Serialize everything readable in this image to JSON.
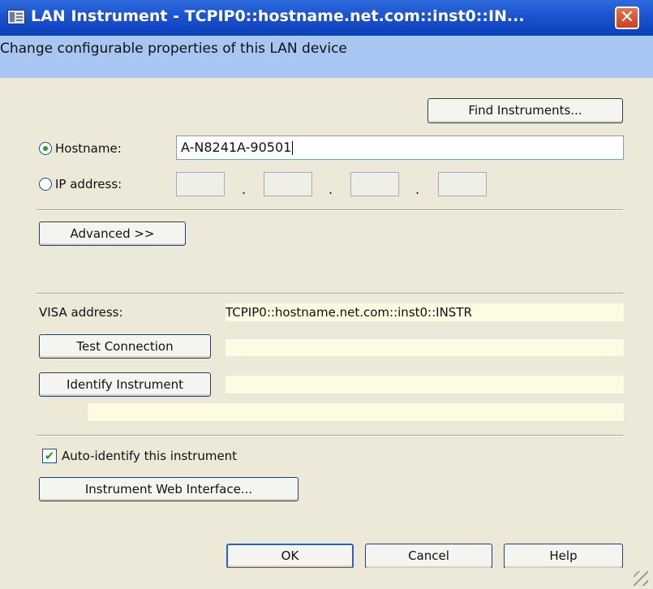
{
  "window": {
    "title": "LAN Instrument - TCPIP0::hostname.net.com::inst0::IN...",
    "description": "Change configurable properties of this LAN device",
    "close_glyph": "✕"
  },
  "buttons": {
    "find_instruments": "Find Instruments...",
    "advanced": "Advanced >>",
    "test_connection": "Test Connection",
    "identify_instrument": "Identify Instrument",
    "web_interface": "Instrument Web Interface...",
    "ok": "OK",
    "cancel": "Cancel",
    "help": "Help"
  },
  "host_mode": {
    "hostname_label": "Hostname:",
    "ip_label": "IP address:",
    "selected": "hostname",
    "hostname_value": "A-N8241A-90501",
    "ip_octets": [
      "",
      "",
      "",
      ""
    ],
    "ip_separator": "."
  },
  "visa": {
    "label": "VISA address:",
    "value": "TCPIP0::hostname.net.com::inst0::INSTR",
    "test_result": "",
    "identify_result_1": "",
    "identify_result_2": ""
  },
  "auto_identify": {
    "label": "Auto-identify this instrument",
    "checked": true,
    "check_glyph": "✔"
  },
  "colors": {
    "titlebar": "#1d55d2",
    "description_band": "#a8c6f2",
    "dialog_face": "#ece9d8",
    "readonly_field": "#fdfbe2",
    "close_button": "#d9532c",
    "check_green": "#21a121"
  }
}
